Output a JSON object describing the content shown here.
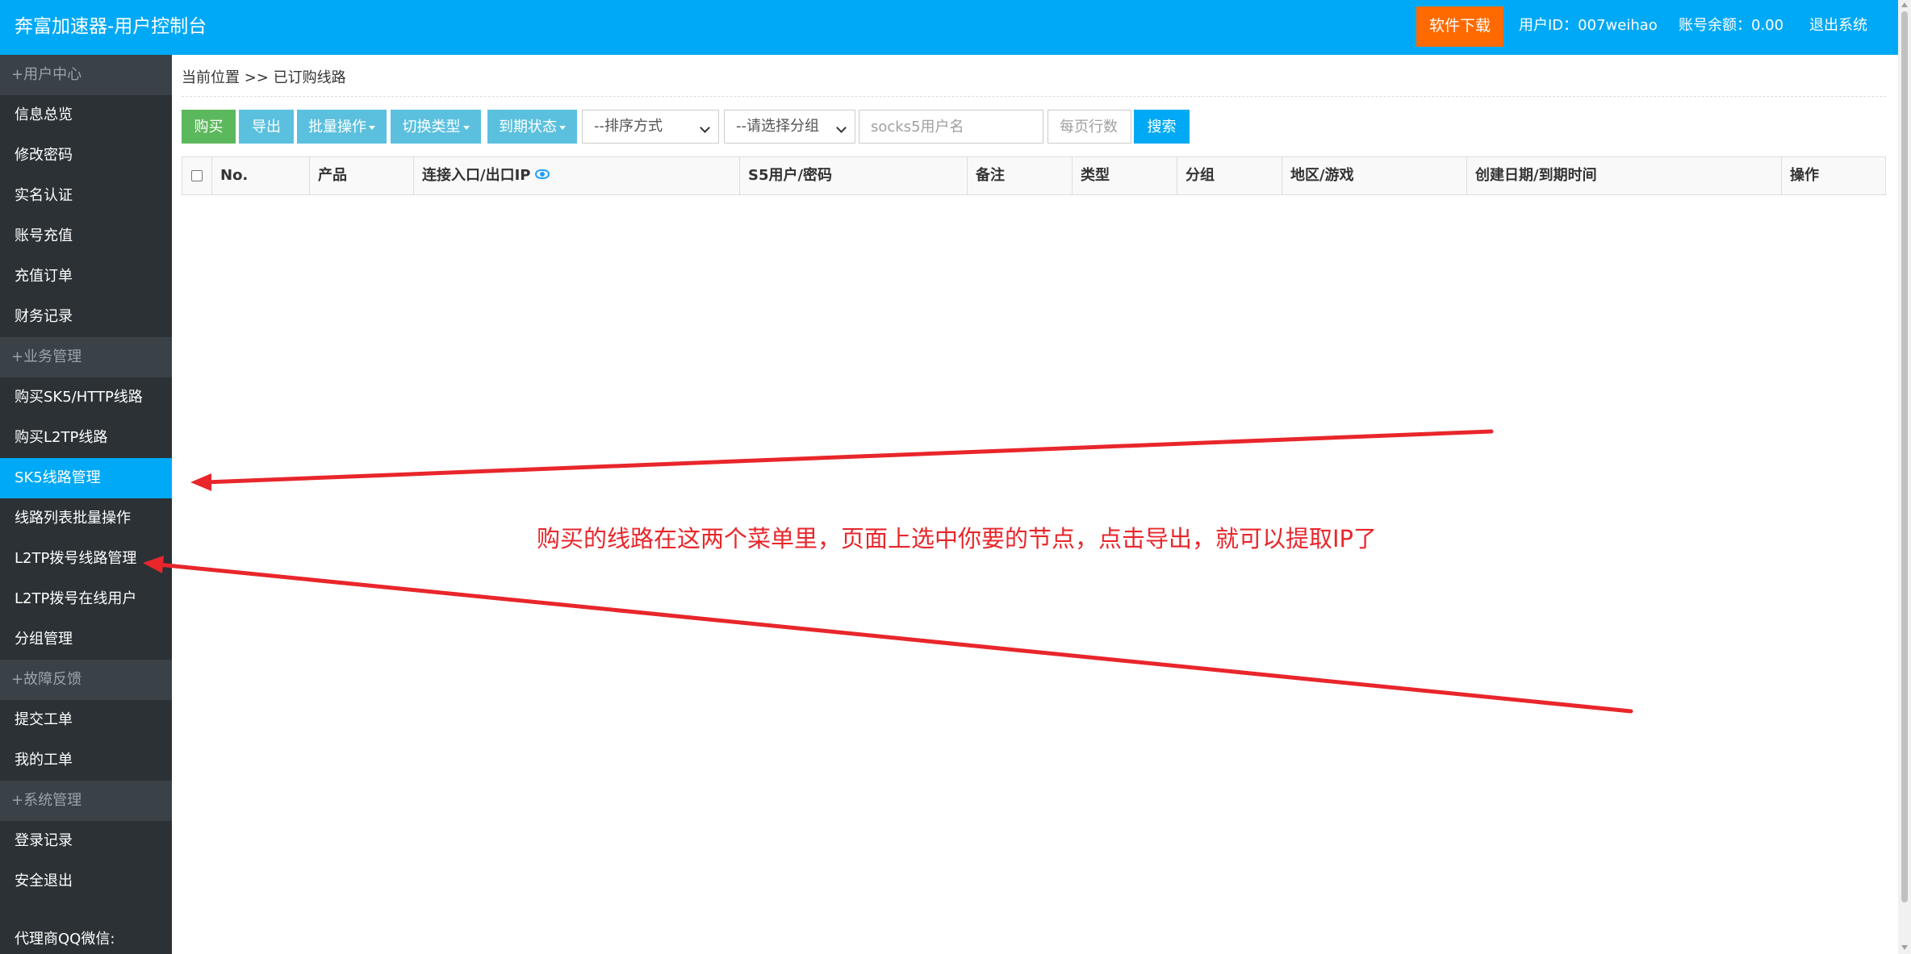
{
  "header": {
    "brand": "奔富加速器-用户控制台",
    "download_label": "软件下载",
    "user_id": "用户ID：007weihao",
    "balance": "账号余额：0.00",
    "logout": "退出系统"
  },
  "sidebar": {
    "groups": [
      {
        "title": "+用户中心",
        "items": [
          "信息总览",
          "修改密码",
          "实名认证",
          "账号充值",
          "充值订单",
          "财务记录"
        ]
      },
      {
        "title": "+业务管理",
        "items": [
          "购买SK5/HTTP线路",
          "购买L2TP线路",
          "SK5线路管理",
          "线路列表批量操作",
          "L2TP拨号线路管理",
          "L2TP拨号在线用户",
          "分组管理"
        ]
      },
      {
        "title": "+故障反馈",
        "items": [
          "提交工单",
          "我的工单"
        ]
      },
      {
        "title": "+系统管理",
        "items": [
          "登录记录",
          "安全退出"
        ]
      }
    ],
    "active_item": "SK5线路管理",
    "footer": "代理商QQ微信:"
  },
  "breadcrumb": "当前位置 >> 已订购线路",
  "toolbar": {
    "buy": "购买",
    "export": "导出",
    "batch": "批量操作",
    "switch_type": "切换类型",
    "expire_status": "到期状态",
    "sort_select": "--排序方式",
    "group_select": "--请选择分组",
    "user_placeholder": "socks5用户名",
    "rows_placeholder": "每页行数",
    "search": "搜索"
  },
  "table": {
    "columns": [
      "No.",
      "产品",
      "连接入口/出口IP",
      "S5用户/密码",
      "备注",
      "类型",
      "分组",
      "地区/游戏",
      "创建日期/到期时间",
      "操作"
    ],
    "rows": []
  },
  "annotation": {
    "text": "购买的线路在这两个菜单里，页面上选中你要的节点，点击导出，就可以提取IP了",
    "color": "#e8262b"
  }
}
